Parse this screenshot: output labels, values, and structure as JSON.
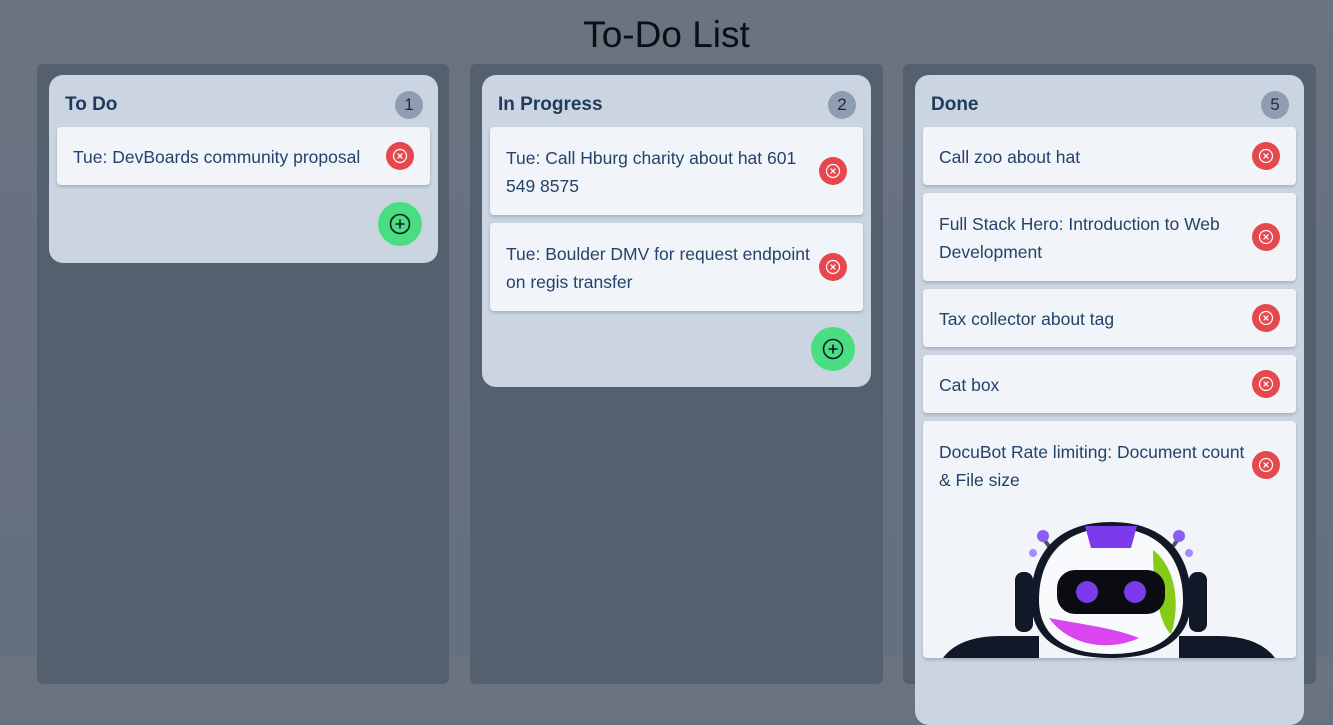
{
  "page": {
    "title": "To-Do List"
  },
  "columns": [
    {
      "title": "To Do",
      "count": "1",
      "cards": [
        "Tue: DevBoards community proposal"
      ]
    },
    {
      "title": "In Progress",
      "count": "2",
      "cards": [
        "Tue: Call Hburg charity about hat 601 549 8575",
        "Tue: Boulder DMV for request endpoint on regis transfer"
      ]
    },
    {
      "title": "Done",
      "count": "5",
      "cards": [
        "Call zoo about hat",
        "Full Stack Hero: Introduction to Web Development",
        "Tax collector about tag",
        "Cat box",
        "DocuBot Rate limiting: Document count & File size"
      ]
    }
  ],
  "icons": {
    "delete": "circle-x-icon",
    "add": "circle-plus-icon",
    "image": "robot-icon"
  },
  "colors": {
    "delete": "#e5484d",
    "add": "#4ade80",
    "panel": "#cbd5e1",
    "column": "#55606f"
  }
}
